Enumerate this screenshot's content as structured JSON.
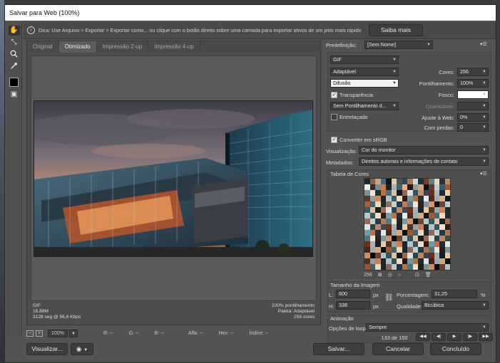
{
  "window": {
    "title": "Salvar para Web (100%)"
  },
  "tip": {
    "text": "Dica: Use Arquivo > Exportar > Exportar como...   ou clique com o botão direito sobre uma camada para exportar ativos de um jeito mais rápido",
    "button": "Saiba mais"
  },
  "tools": [
    "hand-icon",
    "slice-select-icon",
    "zoom-icon",
    "eyedropper-icon"
  ],
  "tabs": [
    {
      "label": "Original"
    },
    {
      "label": "Otimizado",
      "active": true
    },
    {
      "label": "Impressão 2-up"
    },
    {
      "label": "Impressão 4-up"
    }
  ],
  "preview": {
    "info_left": [
      "GIF",
      "16,88M",
      "3128 seg @ 56,6 Kbps"
    ],
    "info_right": [
      "100% pontilhamento",
      "Paleta: Adaptável",
      "256 cores"
    ]
  },
  "status": {
    "minus": "−",
    "plus": "+",
    "zoom": "100%",
    "r": "R: --",
    "g": "G: --",
    "b": "B: --",
    "alpha": "Alfa: --",
    "hex": "Hex: --",
    "index": "Índice: --"
  },
  "buttons": {
    "preview": "Visualizar...",
    "save": "Salvar...",
    "cancel": "Cancelar",
    "done": "Concluído"
  },
  "settings": {
    "preset_label": "Predefinição:",
    "preset_value": "[Sem Nome]",
    "format": "GIF",
    "reduction": "Adaptável",
    "dither_algo": "Difusão",
    "transparency": "Transparência",
    "transparency_dither": "Sem Pontilhamento d...",
    "interlaced": "Entrelaçado",
    "colors_label": "Cores:",
    "colors_value": "256",
    "dither_label": "Pontilhamento:",
    "dither_value": "100%",
    "matte_label": "Fosco:",
    "amount_label": "Quantidade:",
    "web_snap_label": "Ajuste à Web:",
    "web_snap_value": "0%",
    "lossy_label": "Com perdas:",
    "lossy_value": "0",
    "convert_srgb": "Converter em sRGB",
    "preview_label": "Visualização:",
    "preview_value": "Cor do monitor",
    "metadata_label": "Metadados:",
    "metadata_value": "Direitos autorais e informações de contato"
  },
  "color_table": {
    "title": "Tabela de Cores",
    "count": "256",
    "swatches": [
      "#1e2a30",
      "#8b5e4a",
      "#c9a27e",
      "#3d6b76",
      "#0f1618",
      "#e8c9a6",
      "#4b5358",
      "#2c4a52",
      "#a8765a",
      "#d5d8d0",
      "#16323a",
      "#7a3a24",
      "#5e7f88",
      "#edd5b8",
      "#28363c",
      "#b98a66",
      "#f2efe6",
      "#3a2a22",
      "#6c8e96",
      "#c77b4e",
      "#182024",
      "#9fb6ba",
      "#44626a",
      "#e4b48c",
      "#2a1a14",
      "#8aa0a4",
      "#d6a07a",
      "#0a0e10",
      "#5a4034",
      "#c2ccc8",
      "#336068",
      "#a45a36",
      "#7d9298",
      "#f6e4cc",
      "#223038",
      "#b8703e",
      "#4a6e78",
      "#e0c0a0",
      "#141a1e",
      "#926850",
      "#d9e0dc",
      "#2e5660",
      "#c48e66",
      "#38444a",
      "#6a2e1a",
      "#aab8b8",
      "#1a2c34",
      "#ecd0ae",
      "#5c3a2a",
      "#86a4ac",
      "#d88a56",
      "#1c262a",
      "#b0c4c6",
      "#3e5a62",
      "#f0dcc2",
      "#301e16",
      "#729aa2",
      "#c46c3a",
      "#283034",
      "#e2ece8",
      "#4e2c1e",
      "#98b0b4",
      "#dcae84",
      "#10181c",
      "#a65e38",
      "#3c6a74",
      "#eed8bc",
      "#222a2e",
      "#8c7060",
      "#c6d2d0",
      "#1e3e48",
      "#b47e5a",
      "#5a767e",
      "#f4e8d6",
      "#2c2420",
      "#7e98a0",
      "#d49670",
      "#0c1214",
      "#68463a",
      "#bccac8",
      "#345a64",
      "#e6c29c",
      "#1a2226",
      "#9c6e52",
      "#dde4e0",
      "#264a54",
      "#c08a62",
      "#404c52",
      "#742e18",
      "#a4b6b8",
      "#16262c",
      "#eacaa6",
      "#563628",
      "#8ea8ae",
      "#d28454",
      "#1e2a2e",
      "#b4c8ca",
      "#3a5860",
      "#f2e0c6",
      "#2e1c14",
      "#769ea6",
      "#c87040",
      "#26303a",
      "#e4eee8",
      "#4a2a1c",
      "#9cb2b6",
      "#daaa80",
      "#0e161a",
      "#a05a34",
      "#3e6c76",
      "#f0dcc0",
      "#202a30",
      "#906c5c",
      "#c4d0ce",
      "#203e48",
      "#b07c58",
      "#587880",
      "#f2e6d4",
      "#2a2220",
      "#8098a0",
      "#d0946c",
      "#0a1012",
      "#6a4838",
      "#b8c6c4",
      "#325862",
      "#e8c49e",
      "#182024",
      "#9a6c50",
      "#dfe6e2",
      "#244850",
      "#be8860",
      "#3e4a50",
      "#763018",
      "#a2b4b6",
      "#14242a",
      "#ecccaa",
      "#543426",
      "#8ca6ac",
      "#d08052",
      "#1c282c",
      "#b2c6c8",
      "#385660",
      "#f0decc",
      "#2c1a12",
      "#749ca4",
      "#c66e3e",
      "#242e38",
      "#e2ece6",
      "#48281a",
      "#9ab0b4",
      "#d8a87e",
      "#0c1418",
      "#9e5832",
      "#3c6a74",
      "#eedabe",
      "#1e282e",
      "#8e6a5a",
      "#c2cecc",
      "#1e3c46",
      "#ae7a56",
      "#56767e",
      "#f0e4d2",
      "#28201e",
      "#7e969e",
      "#ce926a",
      "#080e10",
      "#684636",
      "#b6c4c2",
      "#305660",
      "#e6c29c",
      "#161e22",
      "#986a4e",
      "#dde4e0",
      "#22464e",
      "#bc865e",
      "#3c484e",
      "#742e16",
      "#a0b2b4",
      "#122228",
      "#eacaa8",
      "#523224",
      "#8aa4aa",
      "#ce7e50",
      "#1a262a",
      "#b0c4c6",
      "#36545e",
      "#eedcca",
      "#2a1810",
      "#729aa2",
      "#c46c3c",
      "#222c36",
      "#e0eae4",
      "#46261a",
      "#98aeb2",
      "#d6a67c",
      "#0a1216",
      "#9c5630",
      "#3a6872",
      "#ecd8bc",
      "#1c262c",
      "#8c6858",
      "#c0ccca",
      "#1c3a44",
      "#ac7854",
      "#54747c",
      "#eee2d0",
      "#261e1c",
      "#7c949c",
      "#cc9068",
      "#060c0e",
      "#664434",
      "#b4c2c0",
      "#2e545e",
      "#e4c09a",
      "#141c20",
      "#96684c",
      "#dbe2de",
      "#20444c",
      "#ba845c",
      "#3a464c",
      "#722c14",
      "#9eb0b2",
      "#102026",
      "#e8c8a6",
      "#503022",
      "#88a2a8",
      "#cc7c4e",
      "#182428",
      "#aec2c4",
      "#34525c",
      "#ecdac8",
      "#28160e",
      "#7098a0",
      "#c26a3a",
      "#202a34",
      "#dee8e2",
      "#442418",
      "#96acb0",
      "#d4a47a",
      "#081014",
      "#9a542e",
      "#386670",
      "#ead6ba",
      "#1a242a",
      "#8a6656",
      "#bec9c7",
      "#1a3842",
      "#aa7652",
      "#52727a",
      "#ece0ce",
      "#241c1a",
      "#7a929a",
      "#ca8e66",
      "#040a0c",
      "#624232",
      "#b2c0be"
    ]
  },
  "image_size": {
    "title": "Tamanho da Imagem",
    "w_label": "L:",
    "w_value": "600",
    "h_label": "H:",
    "h_value": "338",
    "unit": "px",
    "percent_label": "Porcentagem:",
    "percent_value": "31,25",
    "percent_unit": "%",
    "quality_label": "Qualidade:",
    "quality_value": "Bicúbica"
  },
  "animation": {
    "title": "Animação",
    "loop_label": "Opções de loop:",
    "loop_value": "Sempre",
    "frame": "133 de 150"
  }
}
